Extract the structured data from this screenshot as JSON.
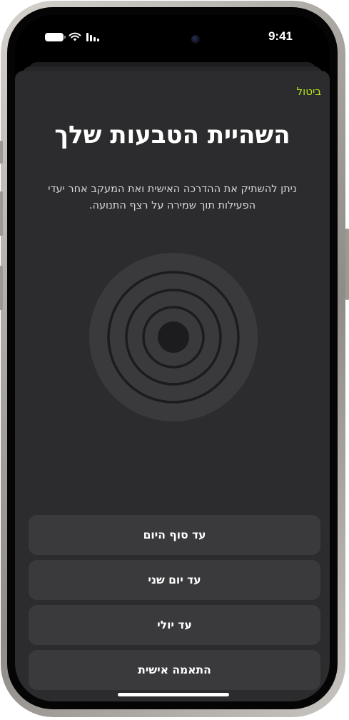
{
  "status_bar": {
    "time": "9:41",
    "icons": [
      "battery-icon",
      "wifi-icon",
      "cellular-signal-icon"
    ]
  },
  "sheet": {
    "cancel_label": "ביטול",
    "title": "השהיית הטבעות שלך",
    "description": "ניתן להשתיק את ההדרכה האישית ואת המעקב אחר יעדי הפעילות תוך שמירה על רצף התנועה.",
    "illustration_icon": "activity-rings-icon"
  },
  "options": [
    {
      "label": "עד סוף היום"
    },
    {
      "label": "עד יום שני"
    },
    {
      "label": "עד יולי"
    },
    {
      "label": "התאמה אישית"
    }
  ],
  "colors": {
    "accent": "#b5e61d",
    "sheet_background": "#2c2c2e",
    "button_background": "#3a3a3c",
    "ring_background": "#3a3a3c",
    "ring_stroke": "#1c1c1e"
  }
}
